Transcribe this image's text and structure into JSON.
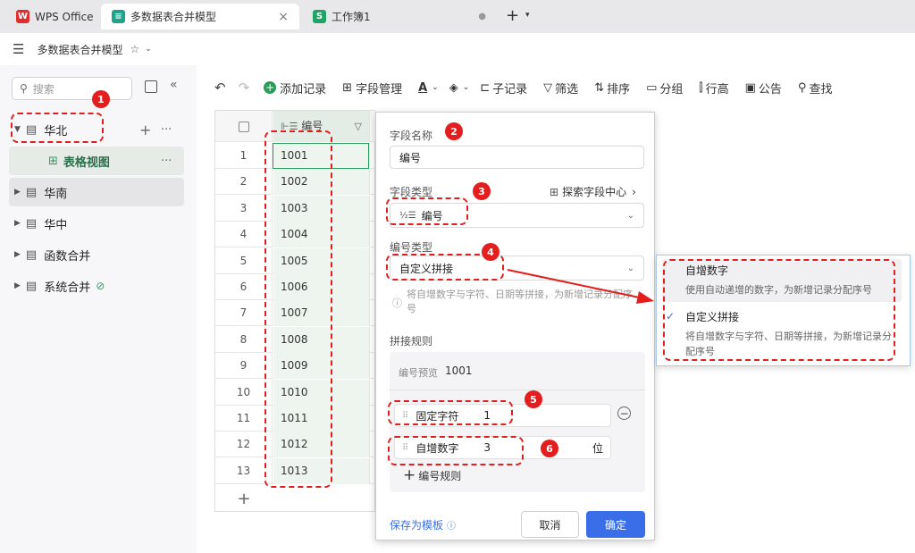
{
  "tabs": [
    {
      "label": "WPS Office",
      "logo": "W"
    },
    {
      "label": "多数据表合并模型",
      "logo": "≡"
    },
    {
      "label": "工作簿1",
      "logo": "S"
    }
  ],
  "titlebar": {
    "title": "多数据表合并模型"
  },
  "sidebar": {
    "search_placeholder": "搜索",
    "items": [
      {
        "label": "华北"
      },
      {
        "label": "表格视图"
      },
      {
        "label": "华南"
      },
      {
        "label": "华中"
      },
      {
        "label": "函数合并"
      },
      {
        "label": "系统合并"
      }
    ]
  },
  "toolbar": {
    "add_record": "添加记录",
    "field_manage": "字段管理",
    "sub_record": "子记录",
    "filter": "筛选",
    "sort": "排序",
    "group": "分组",
    "row_height": "行高",
    "notice": "公告",
    "find": "查找"
  },
  "grid": {
    "column_header": "编号",
    "rows": [
      {
        "n": "1",
        "v": "1001"
      },
      {
        "n": "2",
        "v": "1002"
      },
      {
        "n": "3",
        "v": "1003"
      },
      {
        "n": "4",
        "v": "1004"
      },
      {
        "n": "5",
        "v": "1005"
      },
      {
        "n": "6",
        "v": "1006"
      },
      {
        "n": "7",
        "v": "1007"
      },
      {
        "n": "8",
        "v": "1008"
      },
      {
        "n": "9",
        "v": "1009"
      },
      {
        "n": "10",
        "v": "1010"
      },
      {
        "n": "11",
        "v": "1011"
      },
      {
        "n": "12",
        "v": "1012"
      },
      {
        "n": "13",
        "v": "1013"
      }
    ]
  },
  "panel": {
    "field_name_label": "字段名称",
    "field_name_value": "编号",
    "field_type_label": "字段类型",
    "explore_link": "探索字段中心",
    "field_type_value": "编号",
    "number_type_label": "编号类型",
    "number_type_value": "自定义拼接",
    "hint": "将自增数字与字符、日期等拼接，为新增记录分配序号",
    "rules_label": "拼接规则",
    "preview_label": "编号预览",
    "preview_value": "1001",
    "rule1_name": "固定字符",
    "rule1_value": "1",
    "rule2_name": "自增数字",
    "rule2_value": "3",
    "rule2_unit": "位",
    "add_rule": "编号规则",
    "save_template": "保存为模板",
    "cancel": "取消",
    "confirm": "确定"
  },
  "dropdown": {
    "options": [
      {
        "title": "自增数字",
        "desc": "使用自动递增的数字，为新增记录分配序号"
      },
      {
        "title": "自定义拼接",
        "desc": "将自增数字与字符、日期等拼接，为新增记录分配序号"
      }
    ]
  },
  "badges": [
    "1",
    "2",
    "3",
    "4",
    "5",
    "6"
  ],
  "colors": {
    "accent": "#3a6ee8",
    "highlight": "#e41e1e",
    "field_column": "#eef5ef",
    "green": "#2a9d5c"
  }
}
